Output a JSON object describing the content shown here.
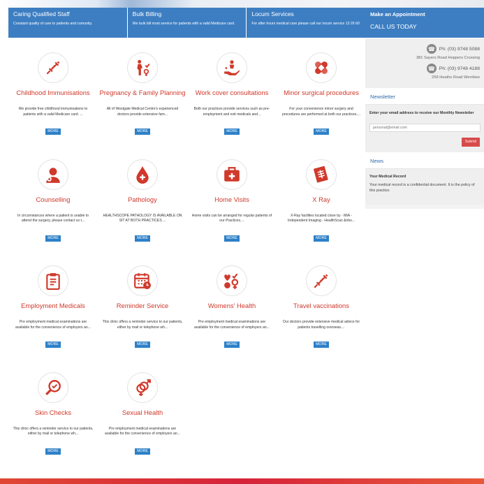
{
  "features": [
    {
      "title": "Caring Qualified Staff",
      "text": "Constant quality of care to patients and comunity."
    },
    {
      "title": "Bulk Billing",
      "text": "We bulk bill most service for patients with a valid Medicare card."
    },
    {
      "title": "Locum Services",
      "text": "For after hours medical care please call our locum service 13 26 60"
    }
  ],
  "services": [
    {
      "title": "Childhood Immunisations",
      "desc": "We provide free childhood immunisations to patients with a valid Medicare card. ...",
      "icon": "syringe-icon"
    },
    {
      "title": "Pregnancy & Family Planning",
      "desc": "All of Westgate Medical Centre's experienced doctors provide extensive fam...",
      "icon": "pregnancy-icon"
    },
    {
      "title": "Work cover consultations",
      "desc": "Both our practices provide services such as pre-employment and exit medicals and...",
      "icon": "hand-care-icon"
    },
    {
      "title": "Minor surgical procedures",
      "desc": "For your convenience minor surgery and procedures are performed at both our practices....",
      "icon": "bandage-icon"
    },
    {
      "title": "Counselling",
      "desc": "In circumstances where a patient is unable to attend the surgery, please contact us t...",
      "icon": "counsellor-icon"
    },
    {
      "title": "Pathology",
      "desc": "HEALTHSCOPE PATHOLOGY IS AVAILABLE ON SIT AT BOTH PRACTICES  ...",
      "icon": "blood-drop-icon"
    },
    {
      "title": "Home Visits",
      "desc": "Home visits can be arranged for regular patients of our Practices....",
      "icon": "medical-kit-icon"
    },
    {
      "title": "X Ray",
      "desc": "X-Ray facilities located close by - MIA - Independent Imaging - HealthScan &nbs...",
      "icon": "xray-icon"
    },
    {
      "title": "Employment Medicals",
      "desc": "Pre employment medical examinations are available for the convenience of employers an...",
      "icon": "clipboard-icon"
    },
    {
      "title": "Reminder Service",
      "desc": "This clinic offers a reminder service to our patients, either by mail or telephone wh...",
      "icon": "calendar-icon"
    },
    {
      "title": "Womens' Health",
      "desc": "Pre employment medical examinations are available for the convenience of employers an...",
      "icon": "female-symbol-icon"
    },
    {
      "title": "Travel vaccinations",
      "desc": "Our doctors provide extensive medical advice for patients travelling overseas....",
      "icon": "syringe-icon"
    },
    {
      "title": "Skin Checks",
      "desc": "This clinic offers a reminder service to our patients, either by mail or telephone wh...",
      "icon": "magnifier-icon"
    },
    {
      "title": "Sexual Health",
      "desc": "Pre employment medical examinations are available for the convenience of employers an...",
      "icon": "gender-symbols-icon"
    }
  ],
  "more_label": "MORE",
  "sidebar": {
    "appointment_title": "Make an Appointment",
    "appointment_cta": "CALL US TODAY",
    "contacts": [
      {
        "phone": "Ph: (03) 9748 5088",
        "address": "381 Sayers Road Hoppers Crossing"
      },
      {
        "phone": "Ph: (03) 9748 4188",
        "address": "259 Heaths Road Werribee"
      }
    ],
    "newsletter_title": "Newsletter",
    "newsletter_label": "Enter your email address to receive our Monthly Newsletter",
    "email_placeholder": "personal@email.com",
    "submit_label": "Submit",
    "news_title": "News",
    "news_item_title": "Your Medical Record",
    "news_item_text": "Your medical record is a confidential document. It is the policy of this practice."
  },
  "colors": {
    "accent_blue": "#3d7ec2",
    "title_red": "#d0392b",
    "button_blue": "#2d80c8",
    "submit_red": "#d74b4b"
  }
}
